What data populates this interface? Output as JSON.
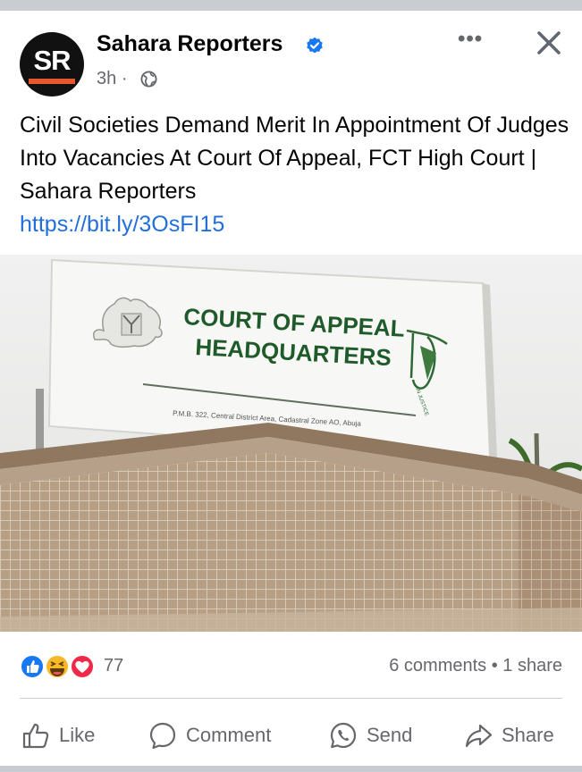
{
  "post": {
    "page_name": "Sahara Reporters",
    "avatar_text": "SR",
    "time": "3h",
    "separator": "·",
    "caption": "Civil Societies Demand Merit In Appointment Of Judges Into Vacancies At Court Of Appeal, FCT High Court | Sahara Reporters",
    "link": "https://bit.ly/3OsFI15"
  },
  "image": {
    "sign_title_line1": "COURT OF APPEAL",
    "sign_title_line2": "HEADQUARTERS",
    "sign_address": "P.M.B. 322, Central District Area, Cadastral Zone AO, Abuja"
  },
  "engagement": {
    "reaction_count": "77",
    "comments_shares": "6 comments • 1 share",
    "reaction_icons": [
      "like-icon",
      "haha-icon",
      "love-icon"
    ]
  },
  "actions": {
    "like": "Like",
    "comment": "Comment",
    "send": "Send",
    "share": "Share"
  },
  "colors": {
    "link": "#216fdb",
    "verified": "#1877f2",
    "sign_text": "#1f5a2a",
    "love": "#f02849"
  }
}
